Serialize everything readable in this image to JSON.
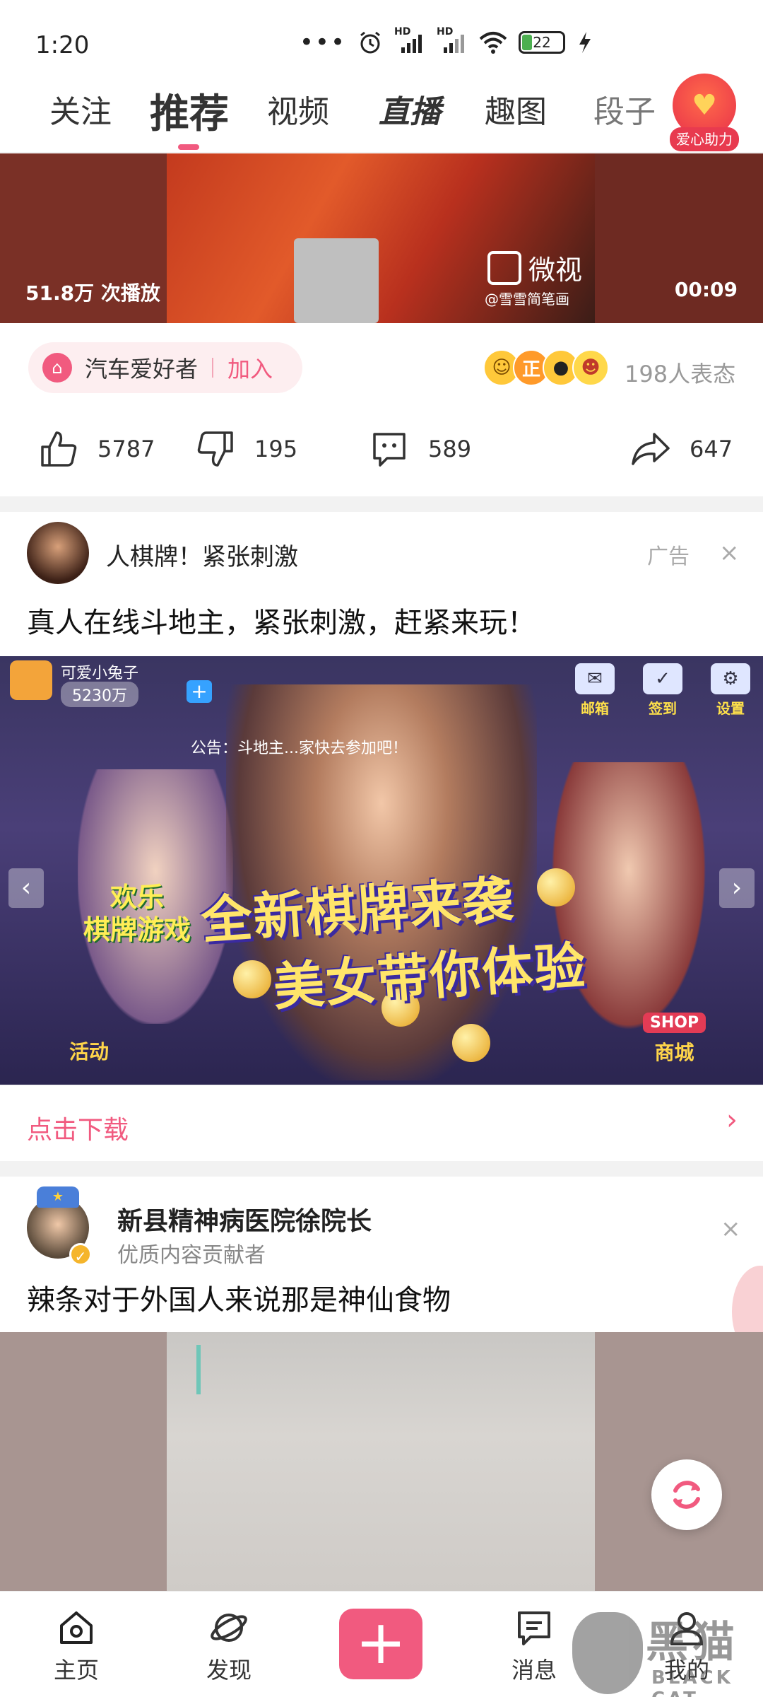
{
  "status_bar": {
    "time": "1:20",
    "signal_1": "HD",
    "signal_2": "HD",
    "battery": "22"
  },
  "top_tabs": {
    "follow": "关注",
    "recommend": "推荐",
    "video": "视频",
    "live": "直播",
    "funny_pics": "趣图",
    "jokes": "段子",
    "love_help": "爱心助力"
  },
  "video_post": {
    "play_count": "51.8万 次播放",
    "duration": "00:09",
    "source_brand": "微视",
    "source_author": "@雪雪简笔画",
    "group_name": "汽车爱好者",
    "join_label": "加入",
    "reaction_count": "198人表态",
    "likes": "5787",
    "dislikes": "195",
    "comments": "589",
    "shares": "647"
  },
  "ad_post": {
    "name": "人棋牌！紧张刺激",
    "ad_label": "广告",
    "title": "真人在线斗地主，紧张刺激，赶紧来玩！",
    "banner": {
      "username": "可爱小兔子",
      "coins": "5230万",
      "mail": "邮箱",
      "signin": "签到",
      "settings": "设置",
      "announcement": "公告：斗地主...家快去参加吧！",
      "left_game_line1": "欢乐",
      "left_game_line2": "棋牌游戏",
      "headline_1": "全新棋牌来袭",
      "headline_2": "美女带你体验",
      "activity": "活动",
      "shop_tag": "SHOP",
      "shop_label": "商城"
    },
    "download_label": "点击下载"
  },
  "post2": {
    "author": "新县精神病医院徐院长",
    "subtitle": "优质内容贡献者",
    "title": "辣条对于外国人来说那是神仙食物"
  },
  "bottom_nav": {
    "home": "主页",
    "discover": "发现",
    "messages": "消息",
    "me": "我的"
  },
  "watermark": {
    "cn": "黑猫",
    "en": "BLACK CAT"
  },
  "colors": {
    "accent": "#f15a7f",
    "live_badge": "#e8314a"
  }
}
